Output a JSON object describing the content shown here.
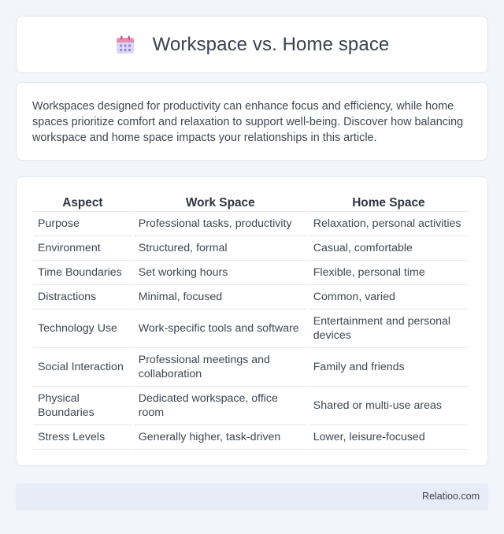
{
  "header": {
    "title": "Workspace vs. Home space",
    "icon": "calendar-icon"
  },
  "intro": {
    "text": "Workspaces designed for productivity can enhance focus and efficiency, while home spaces prioritize comfort and relaxation to support well-being. Discover how balancing workspace and home space impacts your relationships in this article."
  },
  "table": {
    "headers": [
      "Aspect",
      "Work Space",
      "Home Space"
    ],
    "rows": [
      [
        "Purpose",
        "Professional tasks, productivity",
        "Relaxation, personal activities"
      ],
      [
        "Environment",
        "Structured, formal",
        "Casual, comfortable"
      ],
      [
        "Time Boundaries",
        "Set working hours",
        "Flexible, personal time"
      ],
      [
        "Distractions",
        "Minimal, focused",
        "Common, varied"
      ],
      [
        "Technology Use",
        "Work-specific tools and software",
        "Entertainment and personal devices"
      ],
      [
        "Social Interaction",
        "Professional meetings and collaboration",
        "Family and friends"
      ],
      [
        "Physical Boundaries",
        "Dedicated workspace, office room",
        "Shared or multi-use areas"
      ],
      [
        "Stress Levels",
        "Generally higher, task-driven",
        "Lower, leisure-focused"
      ]
    ]
  },
  "footer": {
    "brand": "Relatioo.com"
  },
  "colors": {
    "page_bg": "#f2f5fa",
    "card_bg": "#ffffff",
    "footer_bg": "#e7edf6",
    "icon_accent": "#9c8fe0"
  }
}
